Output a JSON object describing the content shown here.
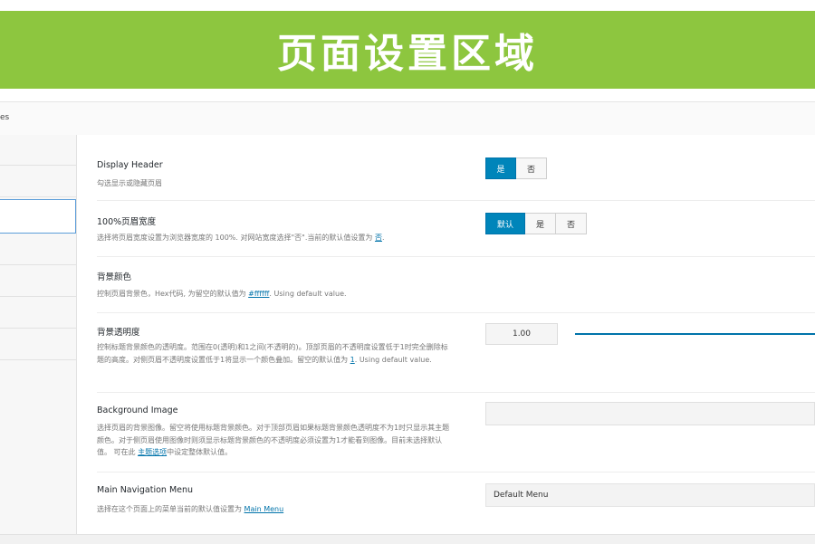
{
  "banner": {
    "title": "页面设置区域",
    "color": "#8dc63f"
  },
  "panel": {
    "top_label": "es"
  },
  "sidebar": {
    "tabs": [
      "",
      "",
      "",
      "",
      "",
      "",
      ""
    ],
    "active_index": 2
  },
  "rows": {
    "display_header": {
      "title": "Display Header",
      "desc": "勾选显示或隐藏页眉",
      "options": [
        "是",
        "否"
      ],
      "selected": "是"
    },
    "header_width": {
      "title": "100%页眉宽度",
      "desc_pre": "选择将页眉宽度设置为浏览器宽度的 100%. 对网站宽度选择\"否\".当前的默认值设置为 ",
      "desc_link": "否",
      "desc_post": ".",
      "options": [
        "默认",
        "是",
        "否"
      ],
      "selected": "默认"
    },
    "bg_color": {
      "title": "背景颜色",
      "desc_pre": "控制页眉背景色，Hex代码, 为留空的默认值为 ",
      "desc_link": "#ffffff",
      "desc_post": ". Using default value."
    },
    "bg_opacity": {
      "title": "背景透明度",
      "desc_pre": "控制标题背景颜色的透明度。范围在0(透明)和1之间(不透明的)。顶部页眉的不透明度设置低于1时完全删除标题的高度。对侧页眉不透明度设置低于1将显示一个颜色叠加。留空的默认值为 ",
      "desc_link": "1",
      "desc_post": ". Using default value.",
      "value": "1.00"
    },
    "bg_image": {
      "title": "Background Image",
      "desc_pre": "选择页眉的背景图像。留空将使用标题背景颜色。对于顶部页眉如果标题背景颜色透明度不为1时只显示其主题颜色。对于侧页眉使用图像时则须显示标题背景颜色的不透明度必须设置为1才能看到图像。目前未选择默认值。 可在此 ",
      "desc_link": "主题选项",
      "desc_post": "中设定整体默认值。"
    },
    "main_nav": {
      "title": "Main Navigation Menu",
      "desc_pre": "选择在这个页面上的菜单当前的默认值设置为 ",
      "desc_link": "Main Menu",
      "desc_post": "",
      "value": "Default Menu"
    }
  }
}
